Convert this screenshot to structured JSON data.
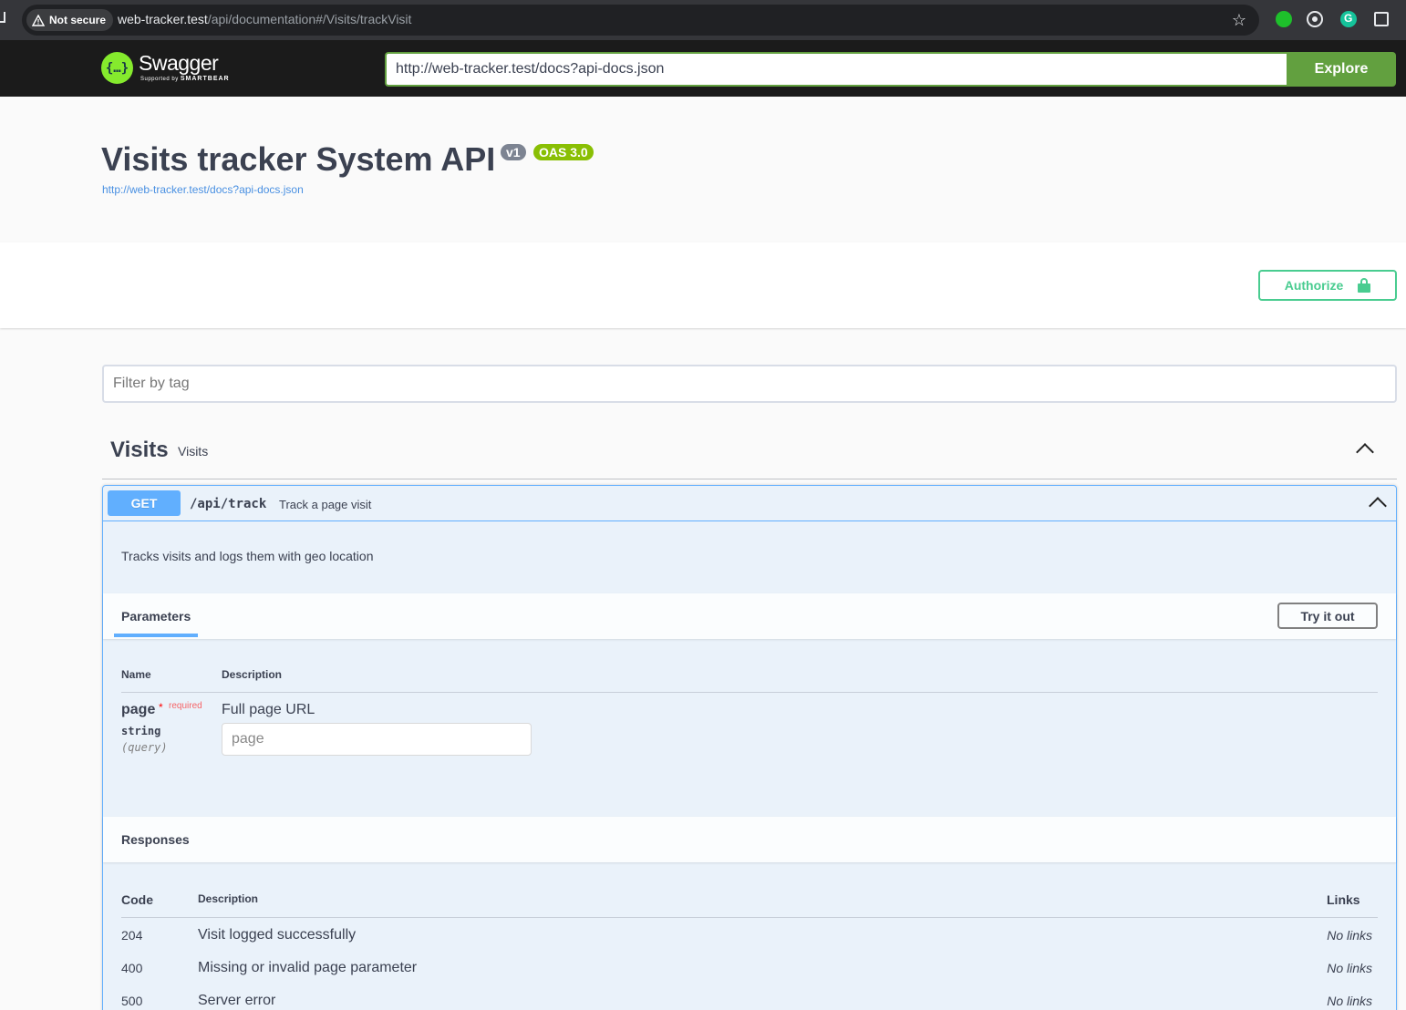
{
  "browser": {
    "security_label": "Not secure",
    "url_host": "web-tracker.test",
    "url_path": "/api/documentation#/Visits/trackVisit"
  },
  "topbar": {
    "logo_text": "Swagger",
    "logo_sub_prefix": "Supported by",
    "logo_sub_brand": "SMARTBEAR",
    "spec_url": "http://web-tracker.test/docs?api-docs.json",
    "explore_label": "Explore"
  },
  "info": {
    "title": "Visits tracker System API",
    "version_badge": "v1",
    "oas_badge": "OAS 3.0",
    "spec_link": "http://web-tracker.test/docs?api-docs.json"
  },
  "authorize_label": "Authorize",
  "filter_placeholder": "Filter by tag",
  "tag": {
    "name": "Visits",
    "description": "Visits"
  },
  "operation": {
    "method": "GET",
    "path": "/api/track",
    "summary": "Track a page visit",
    "description": "Tracks visits and logs them with geo location",
    "parameters_tab": "Parameters",
    "try_it_out_label": "Try it out",
    "param_columns": {
      "name": "Name",
      "description": "Description"
    },
    "parameter": {
      "name": "page",
      "required_star": "*",
      "required_label": "required",
      "type": "string",
      "in": "(query)",
      "description": "Full page URL",
      "placeholder": "page"
    },
    "responses_title": "Responses",
    "response_columns": {
      "code": "Code",
      "description": "Description",
      "links": "Links"
    },
    "responses": [
      {
        "code": "204",
        "description": "Visit logged successfully",
        "links": "No links"
      },
      {
        "code": "400",
        "description": "Missing or invalid page parameter",
        "links": "No links"
      },
      {
        "code": "500",
        "description": "Server error",
        "links": "No links"
      }
    ]
  },
  "colors": {
    "get_accent": "#61affe",
    "authorize_green": "#49cc90",
    "explore_green": "#62a03f",
    "oas_badge": "#89bf04"
  }
}
